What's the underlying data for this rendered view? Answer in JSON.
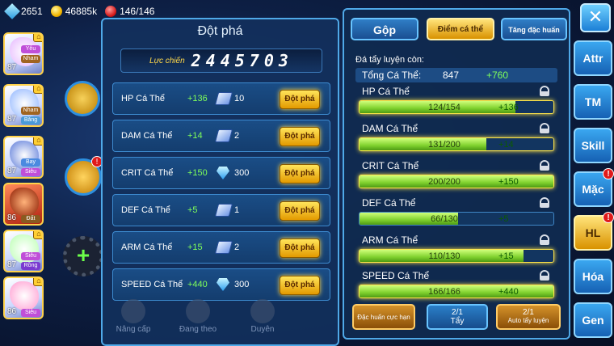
{
  "topbar": {
    "energy": "2651",
    "gold": "46885k",
    "stamina": "146/146"
  },
  "roster": [
    {
      "level": "87",
      "tags": [
        "Yêu",
        "Nham"
      ]
    },
    {
      "level": "87",
      "tags": [
        "Nham",
        "Băng"
      ]
    },
    {
      "level": "87",
      "tags": [
        "Bay",
        "Siêu"
      ]
    },
    {
      "level": "86",
      "tags": [
        "Đất"
      ]
    },
    {
      "level": "87",
      "tags": [
        "Siêu",
        "Rồng"
      ]
    },
    {
      "level": "86",
      "tags": [
        "Siêu"
      ]
    }
  ],
  "breakthrough": {
    "title": "Đột phá",
    "power_label": "Lực chiến",
    "power_value": "2445703",
    "button_label": "Đột phá",
    "rows": [
      {
        "name": "HP Cá Thể",
        "bonus": "+136",
        "cost_icon": "scroll-icon",
        "cost": "10"
      },
      {
        "name": "DAM Cá Thể",
        "bonus": "+14",
        "cost_icon": "scroll-icon",
        "cost": "2"
      },
      {
        "name": "CRIT Cá Thể",
        "bonus": "+150",
        "cost_icon": "diamond-icon",
        "cost": "300"
      },
      {
        "name": "DEF Cá Thể",
        "bonus": "+5",
        "cost_icon": "scroll-icon",
        "cost": "1"
      },
      {
        "name": "ARM Cá Thể",
        "bonus": "+15",
        "cost_icon": "scroll-icon",
        "cost": "2"
      },
      {
        "name": "SPEED Cá Thể",
        "bonus": "+440",
        "cost_icon": "diamond-icon",
        "cost": "300"
      }
    ],
    "bottom_labels": [
      "Nâng cấp",
      "Đang theo",
      "Duyên"
    ]
  },
  "training": {
    "tabs": {
      "merge": "Gộp",
      "points": "Điểm cá thể",
      "special": "Tăng đặc huấn"
    },
    "remaining_label": "Đá tẩy luyện còn:",
    "total_label": "Tổng Cá Thể:",
    "total_value": "847",
    "total_bonus": "+760",
    "stats": [
      {
        "name": "HP Cá Thể",
        "value": "124/154",
        "bonus": "+136",
        "fill": 0.805
      },
      {
        "name": "DAM Cá Thể",
        "value": "131/200",
        "bonus": "+14",
        "fill": 0.655
      },
      {
        "name": "CRIT Cá Thể",
        "value": "200/200",
        "bonus": "+150",
        "fill": 1.0
      },
      {
        "name": "DEF Cá Thể",
        "value": "66/130",
        "bonus": "+5",
        "fill": 0.508
      },
      {
        "name": "ARM Cá Thể",
        "value": "110/130",
        "bonus": "+15",
        "fill": 0.846
      },
      {
        "name": "SPEED Cá Thể",
        "value": "166/166",
        "bonus": "+440",
        "fill": 1.0
      }
    ],
    "actions": {
      "hard_label": "Đặc huấn cực hạn",
      "wash_count": "2/1",
      "wash_label": "Tẩy",
      "auto_count": "2/1",
      "auto_label": "Auto tẩy luyện"
    }
  },
  "sidebar": [
    "Attr",
    "TM",
    "Skill",
    "Mặc",
    "HL",
    "Hóa",
    "Gen"
  ],
  "sidebar_alert": "!"
}
